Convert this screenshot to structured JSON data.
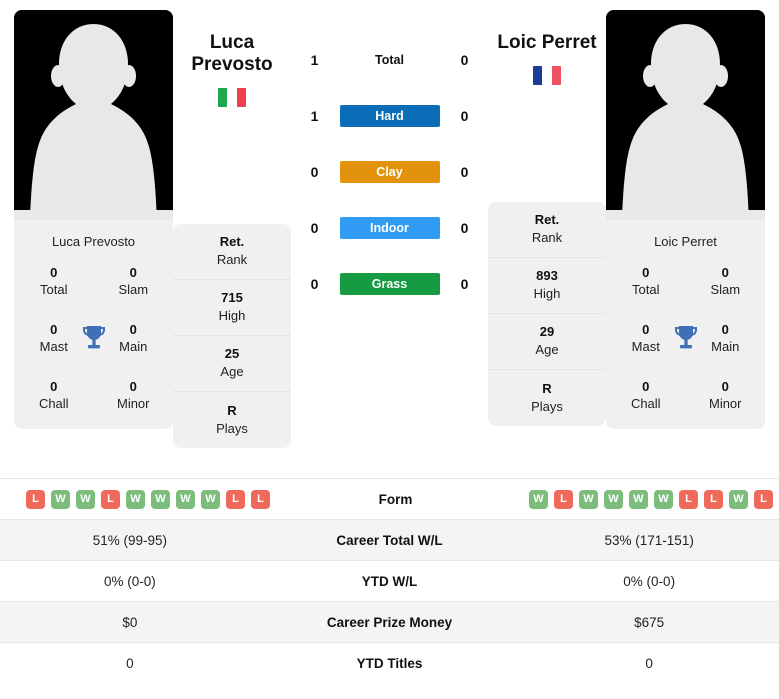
{
  "players": {
    "left": {
      "name": "Luca Prevosto",
      "name_line1": "Luca",
      "name_line2": "Prevosto",
      "flag_colors": [
        "#1ca94c",
        "#ffffff",
        "#ef4050"
      ],
      "flag_name": "italy-flag",
      "avatar_name": "player-avatar-placeholder",
      "titles": {
        "heading": "Luca Prevosto",
        "stats": [
          {
            "value": "0",
            "label": "Total"
          },
          {
            "value": "0",
            "label": "Slam"
          },
          {
            "value": "0",
            "label": "Mast"
          },
          {
            "value": "0",
            "label": "Main"
          },
          {
            "value": "0",
            "label": "Chall"
          },
          {
            "value": "0",
            "label": "Minor"
          }
        ]
      },
      "profile": [
        {
          "value": "Ret.",
          "label": "Rank"
        },
        {
          "value": "715",
          "label": "High"
        },
        {
          "value": "25",
          "label": "Age"
        },
        {
          "value": "R",
          "label": "Plays"
        }
      ],
      "form": [
        "L",
        "W",
        "W",
        "L",
        "W",
        "W",
        "W",
        "W",
        "L",
        "L"
      ]
    },
    "right": {
      "name": "Loic Perret",
      "name_line1": "Loic Perret",
      "name_line2": "",
      "flag_colors": [
        "#1c3c96",
        "#ffffff",
        "#ee5160"
      ],
      "flag_name": "france-flag",
      "avatar_name": "player-avatar-placeholder",
      "titles": {
        "heading": "Loic Perret",
        "stats": [
          {
            "value": "0",
            "label": "Total"
          },
          {
            "value": "0",
            "label": "Slam"
          },
          {
            "value": "0",
            "label": "Mast"
          },
          {
            "value": "0",
            "label": "Main"
          },
          {
            "value": "0",
            "label": "Chall"
          },
          {
            "value": "0",
            "label": "Minor"
          }
        ]
      },
      "profile": [
        {
          "value": "Ret.",
          "label": "Rank"
        },
        {
          "value": "893",
          "label": "High"
        },
        {
          "value": "29",
          "label": "Age"
        },
        {
          "value": "R",
          "label": "Plays"
        }
      ],
      "form": [
        "W",
        "L",
        "W",
        "W",
        "W",
        "W",
        "L",
        "L",
        "W",
        "L"
      ]
    }
  },
  "head_to_head": [
    {
      "label": "Total",
      "left": "1",
      "right": "0",
      "color": "",
      "style": "plain"
    },
    {
      "label": "Hard",
      "left": "1",
      "right": "0",
      "color": "#0b6cb7",
      "style": "badge"
    },
    {
      "label": "Clay",
      "left": "0",
      "right": "0",
      "color": "#e2930b",
      "style": "badge"
    },
    {
      "label": "Indoor",
      "left": "0",
      "right": "0",
      "color": "#2f9bf2",
      "style": "badge"
    },
    {
      "label": "Grass",
      "left": "0",
      "right": "0",
      "color": "#169b43",
      "style": "badge"
    }
  ],
  "comparison_table": {
    "rows": [
      {
        "label": "Form",
        "type": "form",
        "left": "",
        "right": ""
      },
      {
        "label": "Career Total W/L",
        "type": "text",
        "left": "51% (99-95)",
        "right": "53% (171-151)"
      },
      {
        "label": "YTD W/L",
        "type": "text",
        "left": "0% (0-0)",
        "right": "0% (0-0)"
      },
      {
        "label": "Career Prize Money",
        "type": "text",
        "left": "$0",
        "right": "$675"
      },
      {
        "label": "YTD Titles",
        "type": "text",
        "left": "0",
        "right": "0"
      }
    ]
  },
  "colors": {
    "card_bg": "#f0f0f0",
    "row_alt": "#f4f4f4",
    "win": "#7cbd7c",
    "loss": "#ef6a5a",
    "trophy": "#3f6fb5"
  }
}
